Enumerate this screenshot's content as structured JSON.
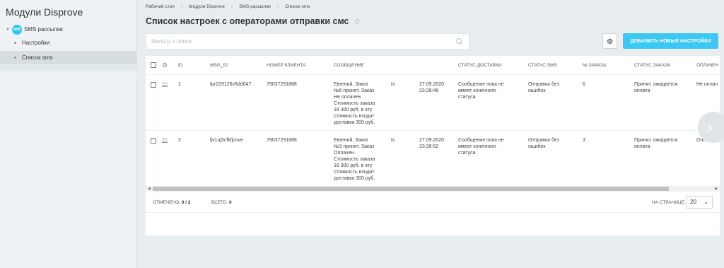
{
  "sidebar": {
    "title": "Модули Disprove",
    "section": {
      "badge": "SMS",
      "label": "SMS рассылки"
    },
    "items": [
      {
        "label": "Настройки"
      },
      {
        "label": "Список sms"
      }
    ]
  },
  "breadcrumbs": [
    "Рабочий стол",
    "Модули Disprove",
    "SMS рассылки",
    "Список sms"
  ],
  "page": {
    "title": "Список настроек с операторами отправки смс"
  },
  "filter": {
    "placeholder": "Фильтр + поиск"
  },
  "toolbar": {
    "add_label": "ДОБАВИТЬ НОВЫЕ НАСТРОЙКИ"
  },
  "grid": {
    "columns": [
      "ID",
      "MSG_ID",
      "НОМЕР КЛИЕНТА",
      "СООБЩЕНИЕ",
      "",
      "",
      "СТАТУС ДОСТАВКИ",
      "СТАТУС SMS",
      "№ ЗАКАЗА",
      "СТАТУС ЗАКАЗА",
      "ОПЛАЧЕН"
    ],
    "rows": [
      {
        "id": "1",
        "msg_id": "fpr229126v6dd047",
        "phone": "79037291888",
        "message": [
          "Евгений, Заказ",
          "№6 принят. Заказ",
          "Не оплачен.",
          "Стоимость заказа",
          "18 300 руб. в эту",
          "стоимость входит",
          "доставка 300 руб."
        ],
        "sender": "ts",
        "date": [
          "27.09.2020",
          "23:28:48"
        ],
        "delivery": [
          "Сообщение пока не",
          "имеет конечного",
          "статуса"
        ],
        "sms_status": [
          "Отправка без",
          "ошибок"
        ],
        "order": "6",
        "order_status": [
          "Принят, ожидается",
          "оплата"
        ],
        "paid": "Не оплач"
      },
      {
        "id": "2",
        "msg_id": "ljv1uj5cfkfjcove",
        "phone": "79037291888",
        "message": [
          "Евгений, Заказ",
          "№3 принят. Заказ",
          "Оплачен.",
          "Стоимость заказа",
          "18 300 руб. в эту",
          "стоимость входит",
          "доставка 300 руб."
        ],
        "sender": "ts",
        "date": [
          "27.09.2020",
          "23:28:52"
        ],
        "delivery": [
          "Сообщение пока не",
          "имеет конечного",
          "статуса"
        ],
        "sms_status": [
          "Отправка без",
          "ошибок"
        ],
        "order": "3",
        "order_status": [
          "Принят, ожидается",
          "оплата"
        ],
        "paid": "Оплачен"
      }
    ]
  },
  "footer": {
    "selected_label": "ОТМЕЧЕНО:",
    "selected_value": "0 / 2",
    "total_label": "ВСЕГО:",
    "total_value": "0",
    "per_page_label": "НА СТРАНИЦЕ:",
    "per_page_value": "20"
  },
  "colors": {
    "accent": "#3bc8f5",
    "sms_badge": "#2fc6f6"
  }
}
